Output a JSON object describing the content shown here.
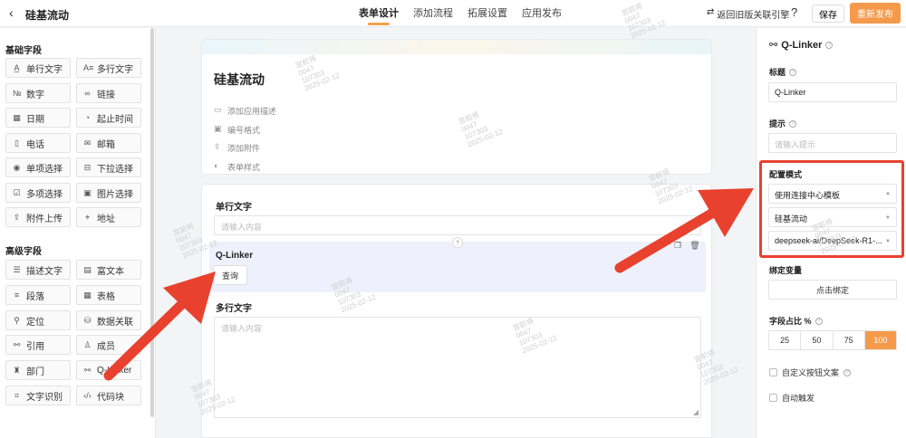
{
  "header": {
    "back_glyph": "‹",
    "app_title": "硅基流动",
    "tabs": [
      {
        "label": "表单设计",
        "active": true
      },
      {
        "label": "添加流程",
        "active": false
      },
      {
        "label": "拓展设置",
        "active": false
      },
      {
        "label": "应用发布",
        "active": false
      }
    ],
    "old_version_link": "返回旧版关联引擎",
    "save_label": "保存",
    "publish_label": "重新发布"
  },
  "left_panel": {
    "basic_title": "基础字段",
    "basic_fields": [
      {
        "label": "单行文字",
        "icon": "A̲"
      },
      {
        "label": "多行文字",
        "icon": "A≡"
      },
      {
        "label": "数字",
        "icon": "№"
      },
      {
        "label": "链接",
        "icon": "∞"
      },
      {
        "label": "日期",
        "icon": "▦"
      },
      {
        "label": "起止时间",
        "icon": "◔"
      },
      {
        "label": "电话",
        "icon": "▯"
      },
      {
        "label": "邮箱",
        "icon": "✉"
      },
      {
        "label": "单项选择",
        "icon": "◉"
      },
      {
        "label": "下拉选择",
        "icon": "⊟"
      },
      {
        "label": "多项选择",
        "icon": "☑"
      },
      {
        "label": "图片选择",
        "icon": "▣"
      },
      {
        "label": "附件上传",
        "icon": "⇪"
      },
      {
        "label": "地址",
        "icon": "⌖"
      }
    ],
    "advanced_title": "高级字段",
    "advanced_fields": [
      {
        "label": "描述文字",
        "icon": "☰"
      },
      {
        "label": "富文本",
        "icon": "▤"
      },
      {
        "label": "段落",
        "icon": "≡"
      },
      {
        "label": "表格",
        "icon": "▦"
      },
      {
        "label": "定位",
        "icon": "⚲"
      },
      {
        "label": "数据关联",
        "icon": "⛁"
      },
      {
        "label": "引用",
        "icon": "⚯"
      },
      {
        "label": "成员",
        "icon": "♙"
      },
      {
        "label": "部门",
        "icon": "♜"
      },
      {
        "label": "Q-Linker",
        "icon": "⚯"
      },
      {
        "label": "文字识别",
        "icon": "⌗"
      },
      {
        "label": "代码块",
        "icon": "‹/›"
      }
    ]
  },
  "form": {
    "title": "硅基流动",
    "header_options": [
      {
        "label": "添加应用描述",
        "icon": "▭"
      },
      {
        "label": "编号格式",
        "icon": "▣"
      },
      {
        "label": "添加附件",
        "icon": "⇪"
      },
      {
        "label": "表单样式",
        "icon": "◐"
      }
    ],
    "fields": [
      {
        "label": "单行文字",
        "placeholder": "请输入内容"
      },
      {
        "label": "Q-Linker",
        "button": "查询"
      },
      {
        "label": "多行文字",
        "placeholder": "请输入内容"
      }
    ]
  },
  "right_panel": {
    "title": "Q-Linker",
    "title_label": "标题",
    "title_value": "Q-Linker",
    "hint_label": "提示",
    "hint_placeholder": "请输入提示",
    "config_label": "配置模式",
    "config_selects": [
      "使用连接中心模板",
      "硅基流动",
      "deepseek-ai/DeepSeek-R1-..."
    ],
    "bind_label": "绑定变量",
    "bind_button": "点击绑定",
    "width_label": "字段占比 %",
    "width_options": [
      "25",
      "50",
      "75",
      "100"
    ],
    "width_selected": "100",
    "custom_button_text": "自定义按钮文案",
    "auto_trigger": "自动触发"
  },
  "watermark": {
    "lines": [
      "宫前将",
      "0047",
      "107303",
      "2025-02-12"
    ]
  },
  "colors": {
    "accent": "#f59a4b",
    "annotation": "#e8412e",
    "selected_bg": "#eef0fb"
  }
}
